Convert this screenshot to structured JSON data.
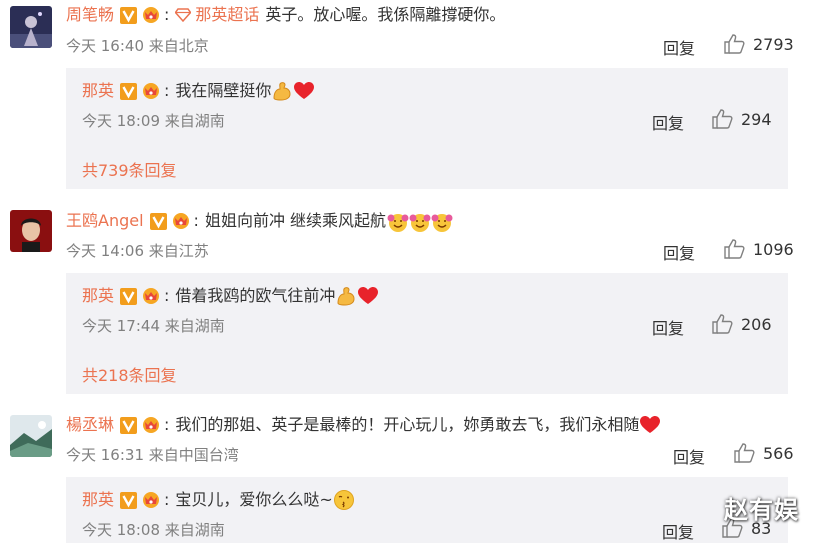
{
  "comments": [
    {
      "username": "周笔畅",
      "topic": "那英超话",
      "text": "英子。放心喔。我係隔離撐硬你。",
      "meta": "今天 16:40 来自北京",
      "reply_label": "回复",
      "likes": "2793",
      "sub": {
        "username": "那英",
        "text": "我在隔壁挺你",
        "emoji": [
          "flexed-biceps",
          "heart"
        ],
        "meta": "今天 18:09 来自湖南",
        "reply_label": "回复",
        "likes": "294",
        "more": "共739条回复"
      }
    },
    {
      "username": "王鸥Angel",
      "text": "姐姐向前冲 继续乘风起航",
      "emoji": [
        "cheer",
        "cheer",
        "cheer"
      ],
      "meta": "今天 14:06 来自江苏",
      "reply_label": "回复",
      "likes": "1096",
      "sub": {
        "username": "那英",
        "text": "借着我鸥的欧气往前冲",
        "emoji": [
          "flexed-biceps",
          "heart"
        ],
        "meta": "今天 17:44 来自湖南",
        "reply_label": "回复",
        "likes": "206",
        "more": "共218条回复"
      }
    },
    {
      "username": "楊丞琳",
      "text": "我们的那姐、英子是最棒的！开心玩儿，妳勇敢去飞，我们永相随",
      "emoji": [
        "heart"
      ],
      "meta": "今天 16:31 来自中国台湾",
      "reply_label": "回复",
      "likes": "566",
      "sub": {
        "username": "那英",
        "text": "宝贝儿，爱你么么哒~",
        "emoji": [
          "kiss-face"
        ],
        "meta": "今天 18:08 来自湖南",
        "reply_label": "回复",
        "likes": "83"
      }
    }
  ],
  "watermark": "赵有娱",
  "colors": {
    "username": "#eb7350",
    "sub_bg": "#f2f2f5",
    "meta": "#808080"
  }
}
